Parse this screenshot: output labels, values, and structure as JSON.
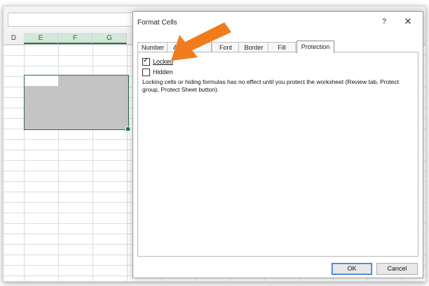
{
  "spreadsheet": {
    "columns": [
      {
        "label": "D",
        "selected": false
      },
      {
        "label": "E",
        "selected": true
      },
      {
        "label": "F",
        "selected": true
      },
      {
        "label": "G",
        "selected": true
      }
    ]
  },
  "dialog": {
    "title": "Format Cells",
    "help_label": "?",
    "close_label": "✕",
    "tabs": [
      {
        "label": "Number",
        "active": false
      },
      {
        "label": "Al",
        "active": false
      },
      {
        "label": "Font",
        "active": false
      },
      {
        "label": "Border",
        "active": false
      },
      {
        "label": "Fill",
        "active": false
      },
      {
        "label": "Protection",
        "active": true
      }
    ],
    "protection": {
      "locked": {
        "label": "Locked",
        "checked": true
      },
      "hidden": {
        "label": "Hidden",
        "checked": false
      },
      "description": "Locking cells or hiding formulas has no effect until you protect the worksheet (Review tab, Protect group, Protect Sheet button)."
    },
    "buttons": {
      "ok": "OK",
      "cancel": "Cancel"
    }
  },
  "colors": {
    "accent_green": "#217346",
    "annotation_arrow": "#f07c1d",
    "selection_fill": "#c4c4c4"
  },
  "icons": [
    "help-icon",
    "close-icon",
    "checkmark-icon",
    "annotation-arrow-icon"
  ]
}
